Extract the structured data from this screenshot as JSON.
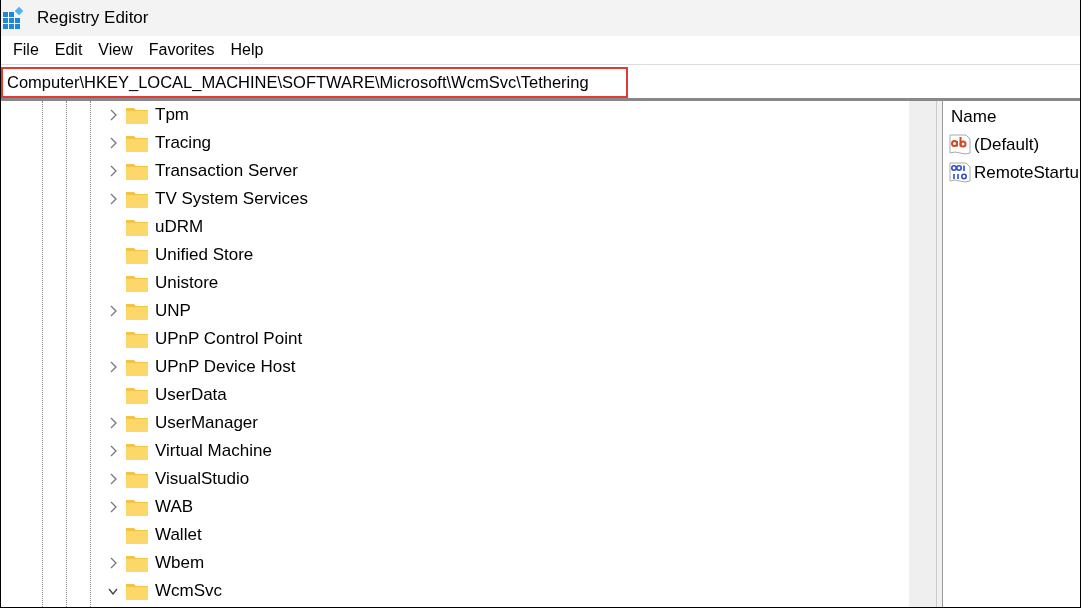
{
  "window": {
    "title": "Registry Editor"
  },
  "menu": [
    "File",
    "Edit",
    "View",
    "Favorites",
    "Help"
  ],
  "address_bar": {
    "value": "Computer\\HKEY_LOCAL_MACHINE\\SOFTWARE\\Microsoft\\WcmSvc\\Tethering",
    "highlighted": true
  },
  "tree": [
    {
      "label": "Tpm",
      "expanded": false
    },
    {
      "label": "Tracing",
      "expanded": false
    },
    {
      "label": "Transaction Server",
      "expanded": false
    },
    {
      "label": "TV System Services",
      "expanded": false
    },
    {
      "label": "uDRM"
    },
    {
      "label": "Unified Store"
    },
    {
      "label": "Unistore"
    },
    {
      "label": "UNP",
      "expanded": false
    },
    {
      "label": "UPnP Control Point"
    },
    {
      "label": "UPnP Device Host",
      "expanded": false
    },
    {
      "label": "UserData"
    },
    {
      "label": "UserManager",
      "expanded": false
    },
    {
      "label": "Virtual Machine",
      "expanded": false
    },
    {
      "label": "VisualStudio",
      "expanded": false
    },
    {
      "label": "WAB",
      "expanded": false
    },
    {
      "label": "Wallet"
    },
    {
      "label": "Wbem",
      "expanded": false
    },
    {
      "label": "WcmSvc",
      "expanded": true
    }
  ],
  "values": {
    "columns": [
      "Name"
    ],
    "rows": [
      {
        "name": "(Default)",
        "kind": "string"
      },
      {
        "name": "RemoteStartu",
        "kind": "binary"
      }
    ]
  }
}
